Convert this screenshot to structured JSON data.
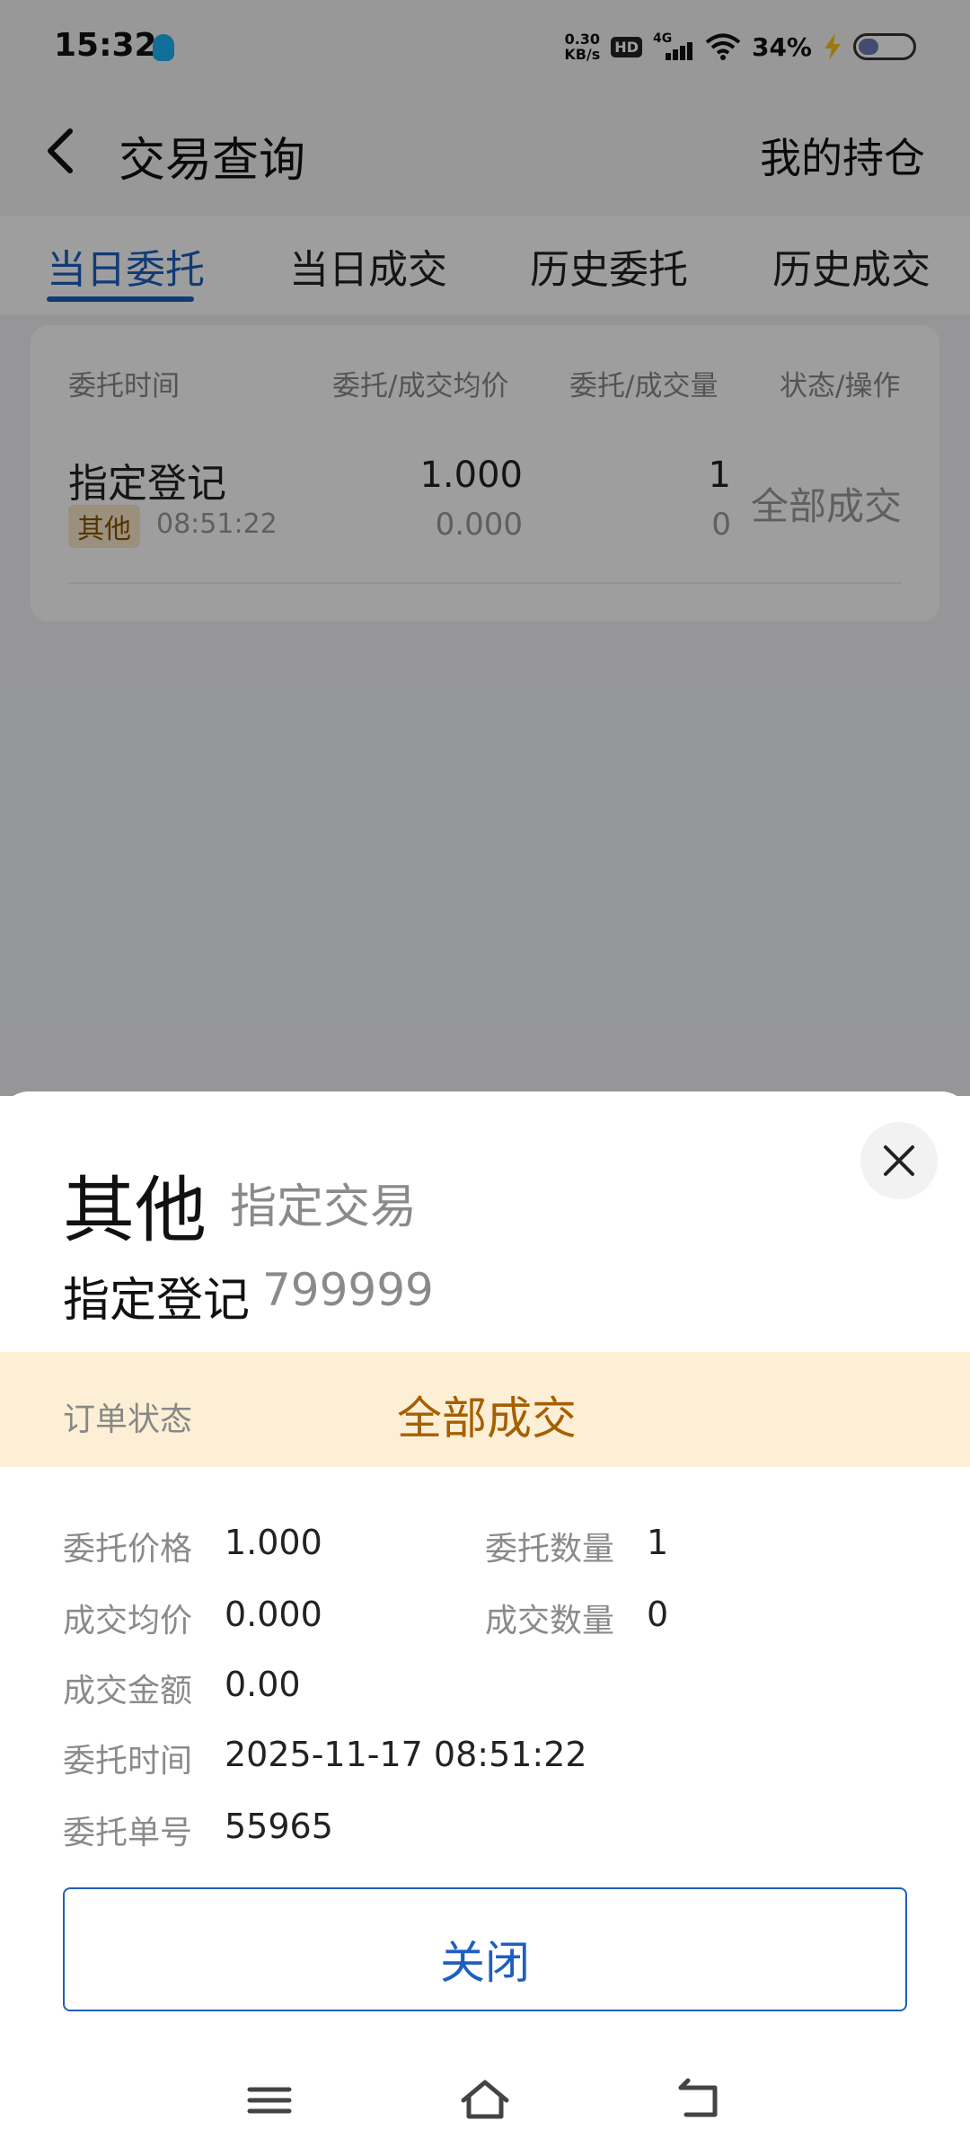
{
  "status_bar": {
    "time": "15:32",
    "speed_value": "0.30",
    "speed_unit": "KB/s",
    "hd": "HD",
    "network": "4G",
    "battery": "34%"
  },
  "header": {
    "title": "交易查询",
    "right_link": "我的持仓"
  },
  "tabs": [
    {
      "label": "当日委托",
      "active": true
    },
    {
      "label": "当日成交",
      "active": false
    },
    {
      "label": "历史委托",
      "active": false
    },
    {
      "label": "历史成交",
      "active": false
    }
  ],
  "table": {
    "headers": [
      "委托时间",
      "委托/成交均价",
      "委托/成交量",
      "状态/操作"
    ],
    "rows": [
      {
        "name": "指定登记",
        "badge": "其他",
        "time": "08:51:22",
        "order_price": "1.000",
        "avg_price": "0.000",
        "order_qty": "1",
        "filled_qty": "0",
        "status": "全部成交"
      }
    ]
  },
  "sheet": {
    "market": "其他",
    "trade_type": "指定交易",
    "stock_name": "指定登记",
    "stock_code": "799999",
    "status_label": "订单状态",
    "status_value": "全部成交",
    "details": {
      "order_price_label": "委托价格",
      "order_price": "1.000",
      "order_qty_label": "委托数量",
      "order_qty": "1",
      "avg_price_label": "成交均价",
      "avg_price": "0.000",
      "filled_qty_label": "成交数量",
      "filled_qty": "0",
      "amount_label": "成交金额",
      "amount": "0.00",
      "time_label": "委托时间",
      "time": "2025-11-17 08:51:22",
      "order_no_label": "委托单号",
      "order_no": "55965"
    },
    "close_button": "关闭"
  },
  "colors": {
    "accent": "#1e5fbf",
    "status_text": "#a65f00",
    "status_banner": "#fdefd6"
  }
}
